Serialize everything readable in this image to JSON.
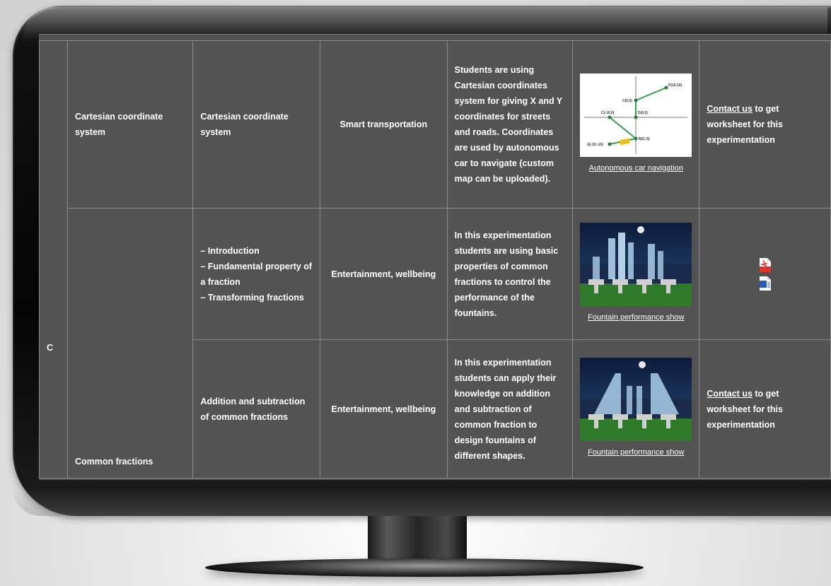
{
  "table": {
    "section_letter": "C",
    "rows": [
      {
        "topic": "Cartesian coordinate system",
        "subtopic_lines": [
          "Cartesian coordinate system"
        ],
        "application": "Smart transportation",
        "description": "Students are using Cartesian coordinates system for giving X and Y coordinates for streets and roads. Coordinates are used by autonomous car to navigate (custom map can be uploaded).",
        "media_caption": "Autonomous car navigation",
        "media_type": "coordinate-plane",
        "worksheet": {
          "link": "Contact us",
          "text": " to get worksheet for this experimentation"
        }
      },
      {
        "topic": "Common fractions",
        "subtopic_lines": [
          "– Introduction",
          "– Fundamental property of a fraction",
          "– Transforming fractions"
        ],
        "application": "Entertainment, wellbeing",
        "description": "In this experimentation students are using basic properties of common fractions to control the performance of the fountains.",
        "media_caption": "Fountain performance show",
        "media_type": "fountain",
        "worksheet_icons": [
          "pdf-file-icon",
          "word-file-icon"
        ]
      },
      {
        "subtopic_lines": [
          "Addition and subtraction of common fractions"
        ],
        "application": "Entertainment, wellbeing",
        "description": "In this experimentation students can apply their knowledge on addition and subtraction of common fraction to design fountains of different shapes.",
        "media_caption": "Fountain performance show",
        "media_type": "fountain",
        "worksheet": {
          "link": "Contact us",
          "text": " to get worksheet for this experimentation"
        }
      }
    ]
  },
  "graph_labels": {
    "p1": "P(10,10)",
    "p2": "C(0,5)",
    "p3": "C(-10,0)",
    "p4": "D(0,0)",
    "p5": "B(5,-5)",
    "p6": "A(-10,-10)"
  },
  "colors": {
    "screen": "#535353",
    "border": "#8a8a8a",
    "text": "#ffffff"
  }
}
